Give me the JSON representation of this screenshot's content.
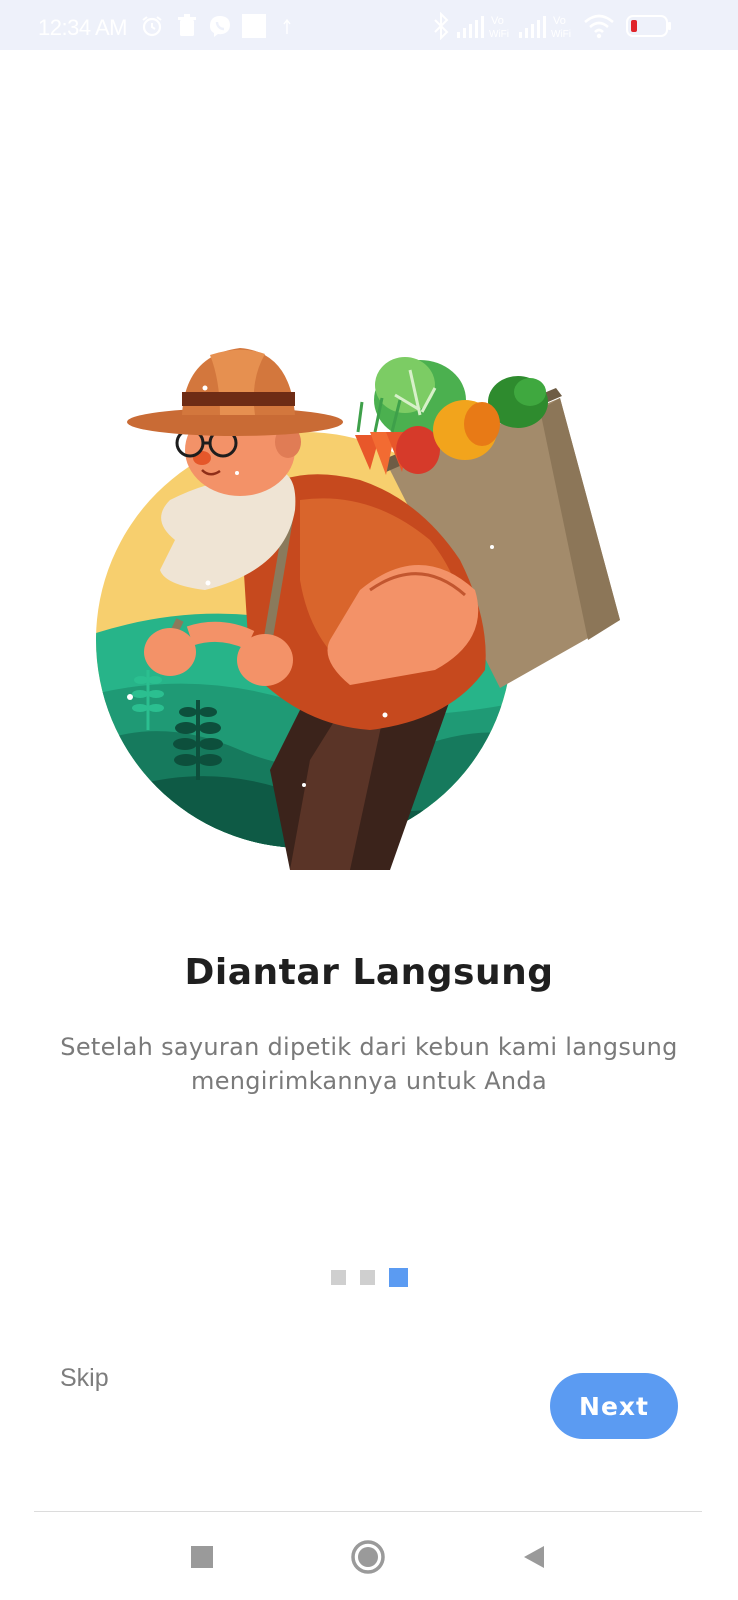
{
  "status_bar": {
    "time": "12:34 AM",
    "icons": [
      "alarm-icon",
      "trash-icon",
      "viber-icon",
      "square-icon",
      "bluetooth-icon",
      "signal-icon",
      "vowifi-icon",
      "signal-icon",
      "vowifi-icon",
      "wifi-icon",
      "battery-icon"
    ],
    "vowifi_label_top": "Vo",
    "vowifi_label_bottom": "WiFi"
  },
  "onboarding": {
    "illustration": "farmer-with-vegetable-basket",
    "title": "Diantar Langsung",
    "description": "Setelah sayuran dipetik dari kebun kami langsung mengirimkannya untuk Anda",
    "page_count": 3,
    "current_page": 3
  },
  "actions": {
    "skip_label": "Skip",
    "next_label": "Next"
  },
  "navigation_bar": {
    "buttons": [
      "recent-apps-icon",
      "home-icon",
      "back-icon"
    ]
  },
  "colors": {
    "accent": "#5b9bf2",
    "title": "#1f1f1f",
    "body_text": "#7a7a7a",
    "inactive_dot": "#cfcfcf",
    "status_bar_bg": "#eef1fa"
  }
}
